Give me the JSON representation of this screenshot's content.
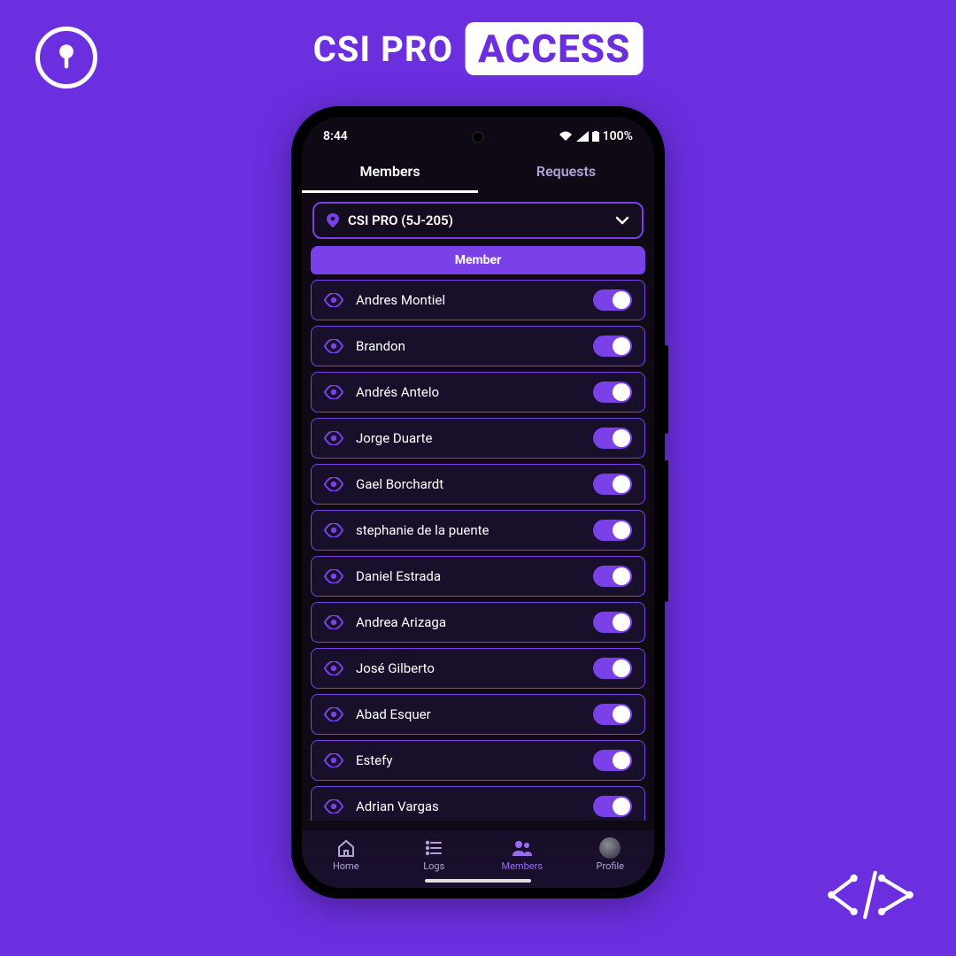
{
  "brand": {
    "prefix": "CSI PRO",
    "badge": "ACCESS"
  },
  "statusbar": {
    "time": "8:44",
    "battery": "100%"
  },
  "tabs": {
    "members": "Members",
    "requests": "Requests",
    "active": "members"
  },
  "location_select": {
    "label": "CSI PRO (5J-205)"
  },
  "section": {
    "header": "Member"
  },
  "members": [
    {
      "name": "Andres Montiel",
      "on": true
    },
    {
      "name": "Brandon",
      "on": true
    },
    {
      "name": "Andrés Antelo",
      "on": true
    },
    {
      "name": "Jorge Duarte",
      "on": true
    },
    {
      "name": "Gael Borchardt",
      "on": true
    },
    {
      "name": "stephanie de la puente",
      "on": true
    },
    {
      "name": "Daniel Estrada",
      "on": true
    },
    {
      "name": "Andrea Arizaga",
      "on": true
    },
    {
      "name": "José Gilberto",
      "on": true
    },
    {
      "name": "Abad Esquer",
      "on": true
    },
    {
      "name": "Estefy",
      "on": true
    },
    {
      "name": "Adrian Vargas",
      "on": true
    }
  ],
  "bottom_nav": {
    "home": "Home",
    "logs": "Logs",
    "members": "Members",
    "profile": "Profile",
    "active": "members"
  }
}
